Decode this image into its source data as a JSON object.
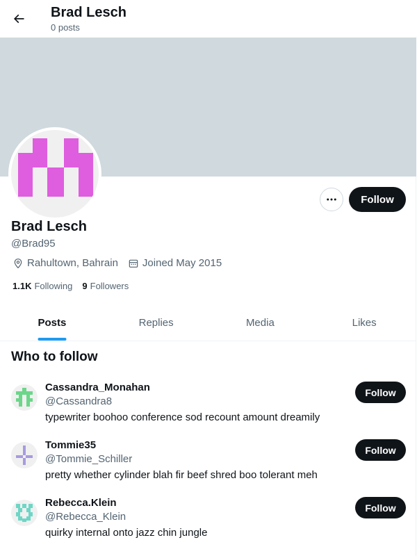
{
  "header": {
    "title": "Brad Lesch",
    "subtitle": "0 posts",
    "back_icon": "arrow-left-icon"
  },
  "profile": {
    "name": "Brad Lesch",
    "handle": "@Brad95",
    "location": "Rahultown, Bahrain",
    "joined": "Joined May 2015",
    "following_count": "1.1K",
    "following_label": "Following",
    "followers_count": "9",
    "followers_label": "Followers",
    "follow_label": "Follow",
    "more_icon": "ellipsis-icon",
    "banner_color": "#cfd9de",
    "avatar_color": "#df5ddf"
  },
  "tabs": [
    {
      "label": "Posts",
      "active": true
    },
    {
      "label": "Replies",
      "active": false
    },
    {
      "label": "Media",
      "active": false
    },
    {
      "label": "Likes",
      "active": false
    }
  ],
  "who_to_follow": {
    "title": "Who to follow",
    "items": [
      {
        "name": "Cassandra_Monahan",
        "handle": "@Cassandra8",
        "bio": "typewriter boohoo conference sod recount amount dreamily",
        "follow_label": "Follow",
        "avatar_color": "#6cd68a"
      },
      {
        "name": "Tommie35",
        "handle": "@Tommie_Schiller",
        "bio": "pretty whether cylinder blah fir beef shred boo tolerant meh",
        "follow_label": "Follow",
        "avatar_color": "#a99ae0"
      },
      {
        "name": "Rebecca.Klein",
        "handle": "@Rebecca_Klein",
        "bio": "quirky internal onto jazz chin jungle",
        "follow_label": "Follow",
        "avatar_color": "#6ed6c6"
      }
    ]
  },
  "accent_color": "#1d9bf0"
}
